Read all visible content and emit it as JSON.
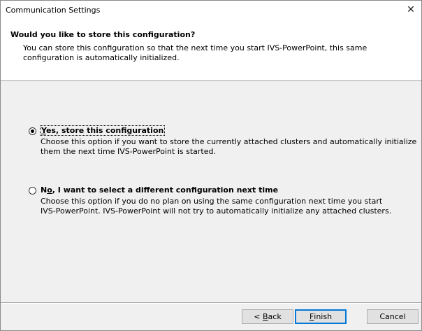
{
  "window": {
    "title": "Communication Settings",
    "close_glyph": "✕"
  },
  "header": {
    "title": "Would you like to store this configuration?",
    "subtitle": "You can store this configuration so that the next time you start IVS-PowerPoint, this same configuration is automatically initialized."
  },
  "options": [
    {
      "mnemonic": "Y",
      "label_rest": "es, store this configuration",
      "selected": true,
      "desc_line1": "Choose this option if you want to store the currently attached clusters and automatically initialize",
      "desc_line2": "them the next time IVS-PowerPoint is started."
    },
    {
      "label_pre": "N",
      "mnemonic": "o",
      "label_rest": ", I want to select a different configuration next time",
      "selected": false,
      "desc_line1": "Choose this option if you do no plan on using the same configuration next time you start",
      "desc_line2": "IVS-PowerPoint. IVS-PowerPoint will not try to automatically initialize any attached clusters."
    }
  ],
  "buttons": {
    "back_prefix": "< ",
    "back_mnemonic": "B",
    "back_rest": "ack",
    "finish_mnemonic": "F",
    "finish_rest": "inish",
    "cancel": "Cancel"
  }
}
